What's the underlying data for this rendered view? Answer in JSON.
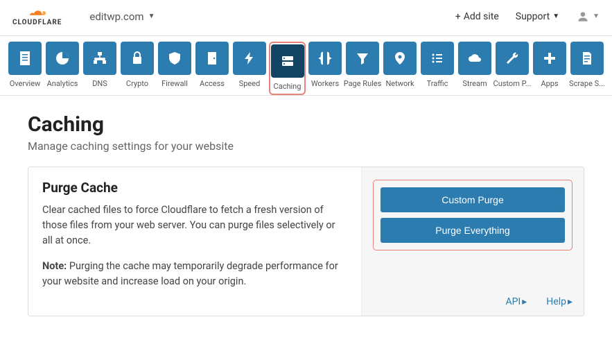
{
  "header": {
    "logo_text": "CLOUDFLARE",
    "domain": "editwp.com",
    "add_site": "Add site",
    "support": "Support"
  },
  "nav": [
    {
      "label": "Overview"
    },
    {
      "label": "Analytics"
    },
    {
      "label": "DNS"
    },
    {
      "label": "Crypto"
    },
    {
      "label": "Firewall"
    },
    {
      "label": "Access"
    },
    {
      "label": "Speed"
    },
    {
      "label": "Caching"
    },
    {
      "label": "Workers"
    },
    {
      "label": "Page Rules"
    },
    {
      "label": "Network"
    },
    {
      "label": "Traffic"
    },
    {
      "label": "Stream"
    },
    {
      "label": "Custom P..."
    },
    {
      "label": "Apps"
    },
    {
      "label": "Scrape S..."
    }
  ],
  "page": {
    "title": "Caching",
    "subtitle": "Manage caching settings for your website"
  },
  "card": {
    "title": "Purge Cache",
    "desc": "Clear cached files to force Cloudflare to fetch a fresh version of those files from your web server. You can purge files selectively or all at once.",
    "note_label": "Note:",
    "note_text": " Purging the cache may temporarily degrade performance for your website and increase load on your origin.",
    "custom_purge": "Custom Purge",
    "purge_everything": "Purge Everything",
    "api_link": "API",
    "help_link": "Help"
  }
}
